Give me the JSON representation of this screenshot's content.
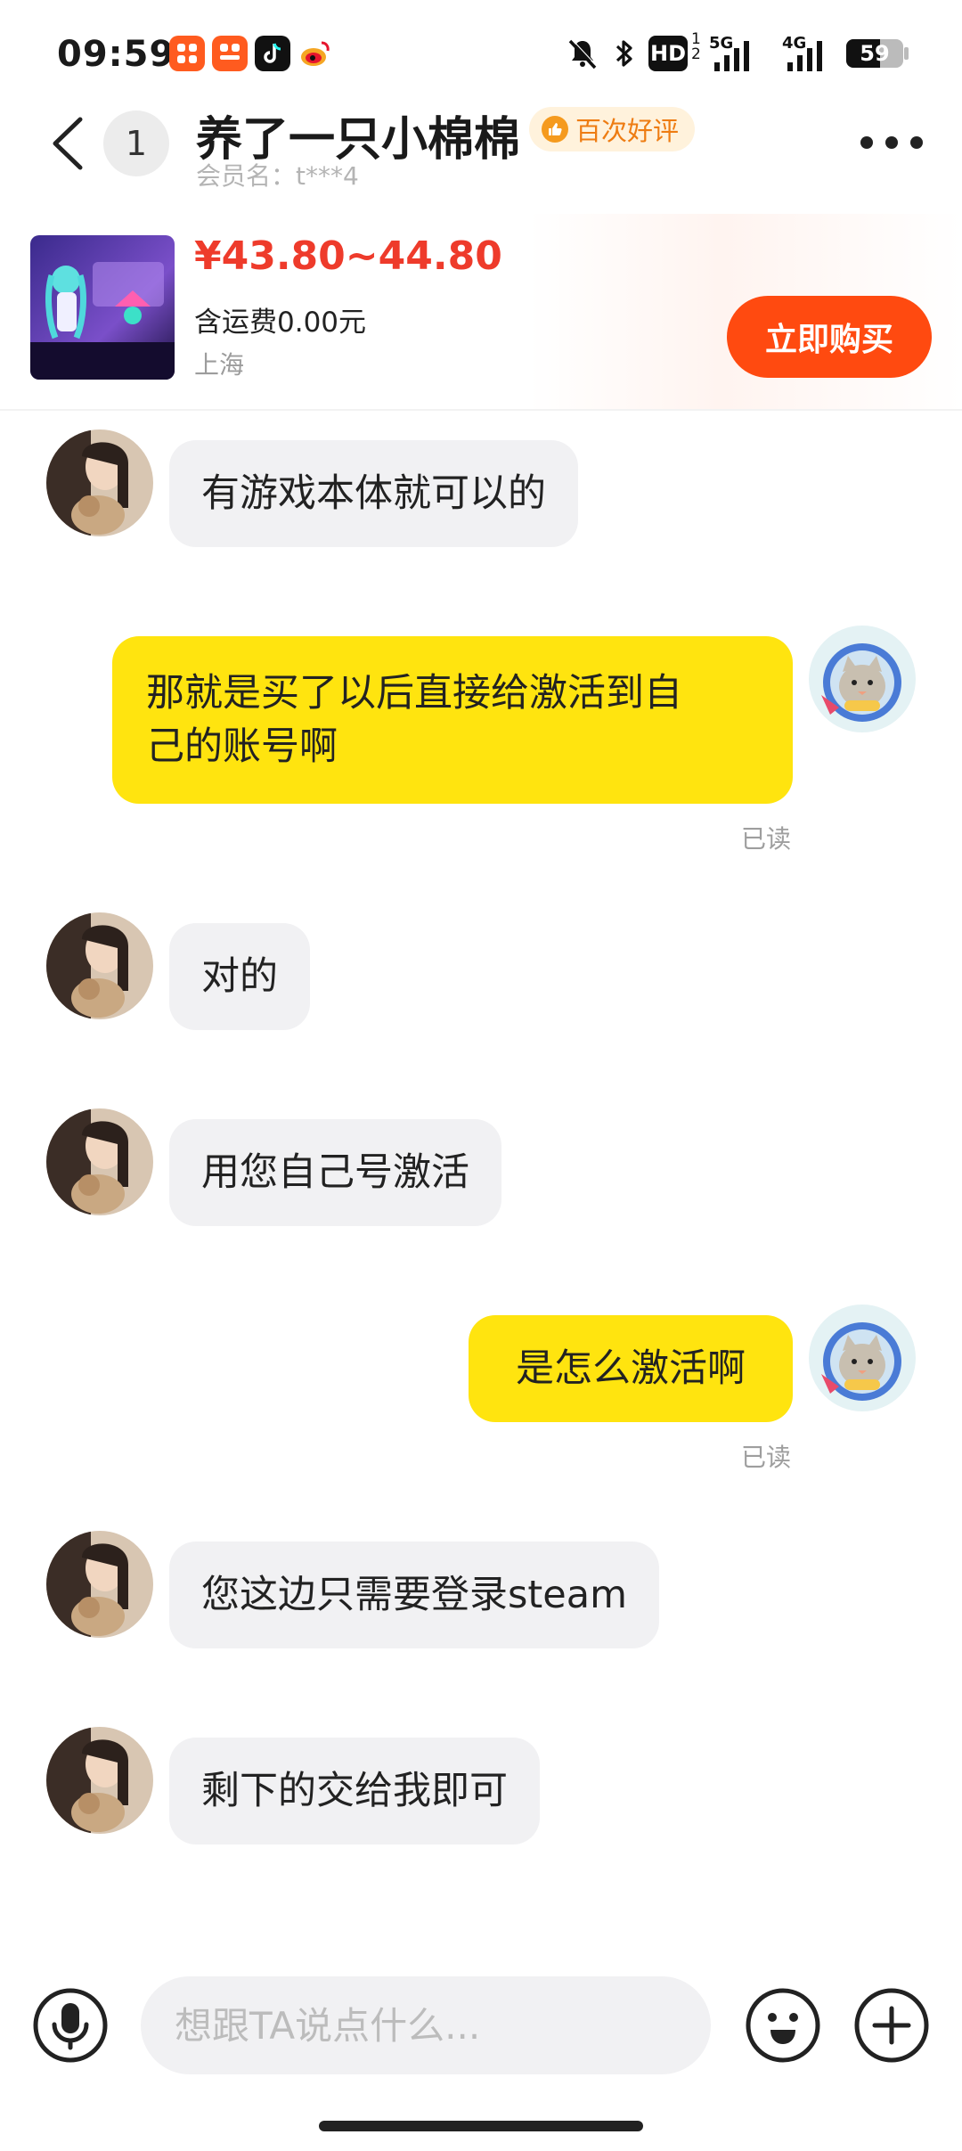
{
  "status_bar": {
    "time": "09:59",
    "hd_label": "HD",
    "net_5g": "5G",
    "net_4g": "4G",
    "battery": "59"
  },
  "header": {
    "unread_count": "1",
    "nickname": "养了一只小棉棉",
    "rating_badge": "百次好评",
    "member_label": "会员名：t***4"
  },
  "product": {
    "price": "¥43.80~44.80",
    "shipping": "含运费0.00元",
    "location": "上海",
    "buy_label": "立即购买"
  },
  "messages": [
    {
      "side": "in",
      "text": "有游戏本体就可以的"
    },
    {
      "side": "out",
      "line1": "那就是买了以后直接给激活到自",
      "line2": "己的账号啊",
      "status": "已读"
    },
    {
      "side": "in",
      "text": "对的"
    },
    {
      "side": "in",
      "text": "用您自己号激活"
    },
    {
      "side": "out",
      "text": "是怎么激活啊",
      "status": "已读"
    },
    {
      "side": "in",
      "text": "您这边只需要登录steam"
    },
    {
      "side": "in",
      "text": "剩下的交给我即可"
    }
  ],
  "input_bar": {
    "placeholder": "想跟TA说点什么..."
  },
  "colors": {
    "accent": "#ff4a10",
    "price": "#ee3b2b",
    "out_bubble": "#ffe40f",
    "in_bubble": "#f1f1f3"
  }
}
